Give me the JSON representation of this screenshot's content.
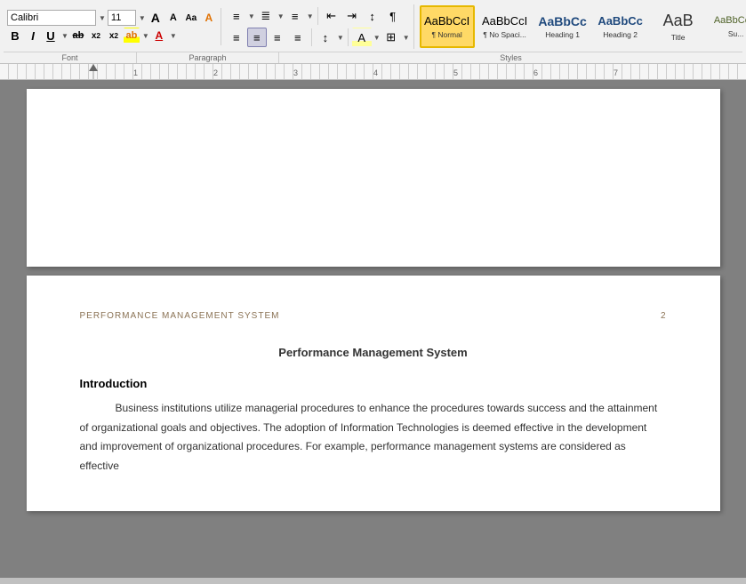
{
  "toolbar": {
    "font_name": "Calibri",
    "font_size": "11",
    "font_section_label": "Font",
    "paragraph_section_label": "Paragraph",
    "styles_section_label": "Styles",
    "font_grow_label": "A",
    "font_shrink_label": "A",
    "bold_label": "B",
    "italic_label": "I",
    "underline_label": "U",
    "strikethrough_label": "ab",
    "subscript_label": "x₂",
    "superscript_label": "x²"
  },
  "styles": [
    {
      "id": "normal",
      "preview": "AaBbCcI",
      "label": "¶ Normal",
      "active": true
    },
    {
      "id": "no-spacing",
      "preview": "AaBbCcI",
      "label": "¶ No Spaci...",
      "active": false
    },
    {
      "id": "heading1",
      "preview": "AaBbCc",
      "label": "Heading 1",
      "active": false
    },
    {
      "id": "heading2",
      "preview": "AaBbCc",
      "label": "Heading 2",
      "active": false
    },
    {
      "id": "title",
      "preview": "AaB",
      "label": "Title",
      "active": false
    },
    {
      "id": "subtitle",
      "preview": "AaBbCc...",
      "label": "Su...",
      "active": false
    }
  ],
  "ruler": {
    "visible": true
  },
  "page1": {
    "blank": true
  },
  "page2": {
    "header_text": "PERFORMANCE MANAGEMENT SYSTEM",
    "header_page_number": "2",
    "document_title": "Performance Management System",
    "section_heading": "Introduction",
    "paragraph1": "Business institutions utilize managerial procedures to enhance the procedures towards success and the attainment of organizational goals and objectives. The adoption of Information Technologies is deemed effective in the development and improvement of organizational procedures. For example, performance management systems are considered as effective"
  }
}
